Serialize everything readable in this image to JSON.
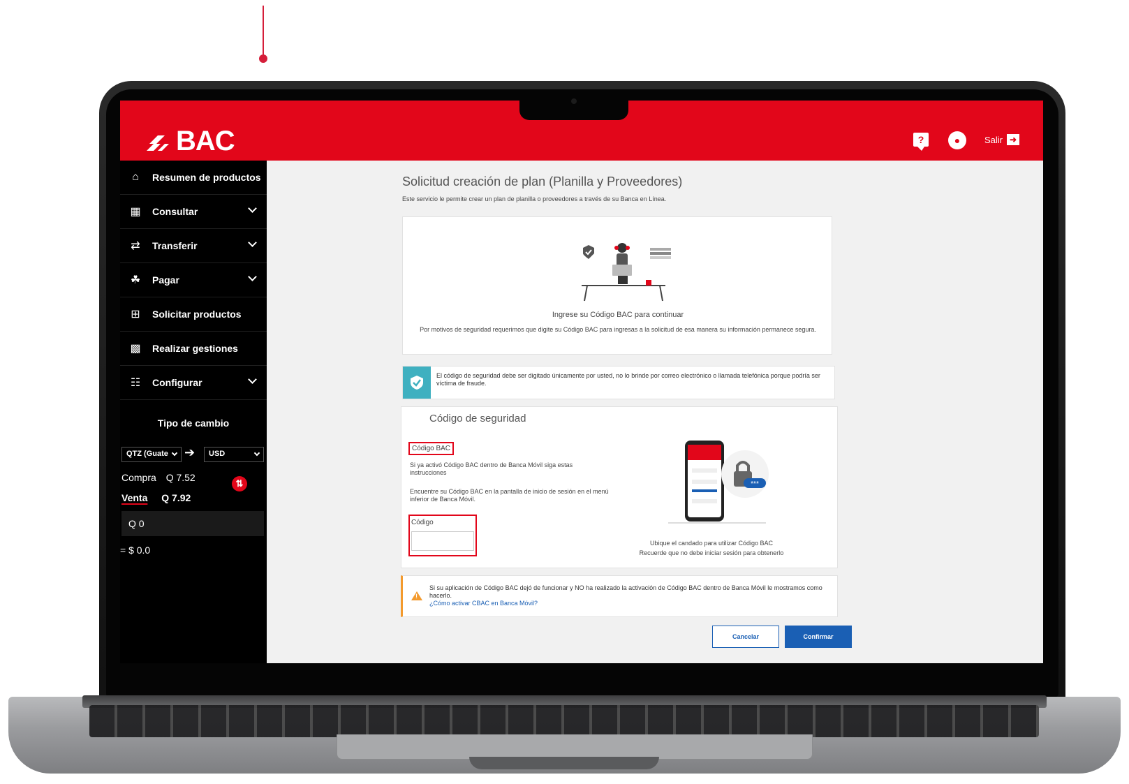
{
  "header": {
    "logo_text": "BAC",
    "help_icon": "?",
    "bell_icon": "bell-icon",
    "logout_label": "Salir"
  },
  "sidebar": {
    "items": [
      {
        "label": "Resumen de productos",
        "icon": "home-icon",
        "has_chevron": false
      },
      {
        "label": "Consultar",
        "icon": "grid-icon",
        "has_chevron": true
      },
      {
        "label": "Transferir",
        "icon": "transfer-icon",
        "has_chevron": true
      },
      {
        "label": "Pagar",
        "icon": "money-bag-icon",
        "has_chevron": true
      },
      {
        "label": "Solicitar productos",
        "icon": "add-square-icon",
        "has_chevron": false
      },
      {
        "label": "Realizar gestiones",
        "icon": "computer-icon",
        "has_chevron": false
      },
      {
        "label": "Configurar",
        "icon": "sliders-icon",
        "has_chevron": true
      }
    ],
    "exchange": {
      "title": "Tipo de cambio",
      "from_currency": "QTZ (Guate",
      "to_currency": "USD",
      "compra_label": "Compra",
      "compra_value": "Q 7.52",
      "venta_label": "Venta",
      "venta_value": "Q 7.92",
      "amount_value": "Q  0",
      "result": "= $ 0.0"
    }
  },
  "main": {
    "title": "Solicitud creación de plan (Planilla y Proveedores)",
    "description": "Este servicio le permite crear un plan de planilla o proveedores a través de su Banca en Línea.",
    "intro": {
      "title": "Ingrese su Código BAC para continuar",
      "text": "Por motivos de seguridad requerimos que digite su Código BAC para ingresas a la solicitud de esa manera su información permanece segura."
    },
    "notice": {
      "text": "El código de seguridad debe ser digitado únicamente por usted, no lo brinde por correo electrónico o llamada telefónica porque podría ser víctima de fraude."
    },
    "security": {
      "title": "Código de seguridad",
      "codigo_bac_label": "Código BAC",
      "instruction_1": "Si ya activó Código BAC dentro de Banca Móvil siga estas instrucciones",
      "instruction_2": "Encuentre su Código BAC en la pantalla de inicio de sesión en el menú inferior de Banca Móvil.",
      "codigo_field_label": "Código",
      "codigo_field_value": "",
      "caption_1": "Ubique el candado para utilizar Código BAC",
      "caption_2": "Recuerde que no debe iniciar sesión para obtenerlo"
    },
    "warning": {
      "text": "Si su aplicación de Código BAC dejó de funcionar y NO ha realizado la activación de Código BAC dentro de Banca Móvil le mostramos como hacerlo.",
      "link": "¿Cómo activar CBAC en Banca Móvil?"
    },
    "buttons": {
      "cancel": "Cancelar",
      "confirm": "Confirmar"
    }
  },
  "colors": {
    "brand_red": "#e2061a",
    "link_blue": "#1a5fb4",
    "notice_teal": "#3fb0c0",
    "warning_orange": "#f39a2d"
  }
}
